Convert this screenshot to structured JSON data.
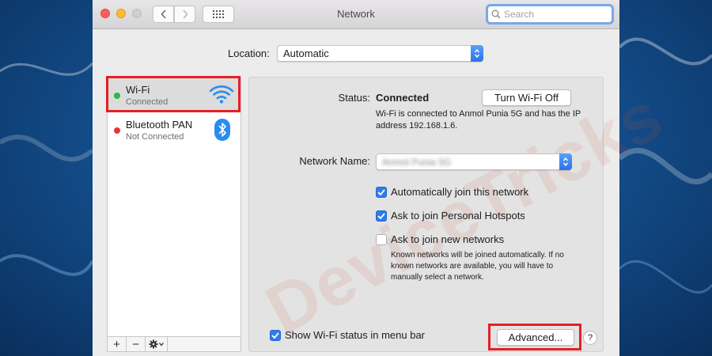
{
  "window": {
    "title": "Network",
    "search_placeholder": "Search"
  },
  "location": {
    "label": "Location:",
    "value": "Automatic"
  },
  "services": [
    {
      "name": "Wi-Fi",
      "status": "Connected",
      "status_color": "#2cb84a",
      "icon": "wifi-icon",
      "selected": true
    },
    {
      "name": "Bluetooth PAN",
      "status": "Not Connected",
      "status_color": "#e8343a",
      "icon": "bluetooth-icon",
      "selected": false
    }
  ],
  "sidebar_toolbar": {
    "add_label": "+",
    "remove_label": "−"
  },
  "detail": {
    "status_label": "Status:",
    "status_value": "Connected",
    "turn_off_label": "Turn Wi-Fi Off",
    "status_description": "Wi-Fi is connected to Anmol Punia 5G and has the IP address 192.168.1.6.",
    "network_name_label": "Network Name:",
    "network_name_value": "Anmol Punia 5G",
    "options": [
      {
        "label": "Automatically join this network",
        "checked": true
      },
      {
        "label": "Ask to join Personal Hotspots",
        "checked": true
      },
      {
        "label": "Ask to join new networks",
        "checked": false
      }
    ],
    "options_note": "Known networks will be joined automatically. If no known networks are available, you will have to manually select a network.",
    "show_status_label": "Show Wi-Fi status in menu bar",
    "show_status_checked": true,
    "advanced_label": "Advanced...",
    "help_label": "?"
  },
  "watermark": "DeviceTricks",
  "colors": {
    "highlight": "#e41f26",
    "accent": "#2f7ce8"
  }
}
